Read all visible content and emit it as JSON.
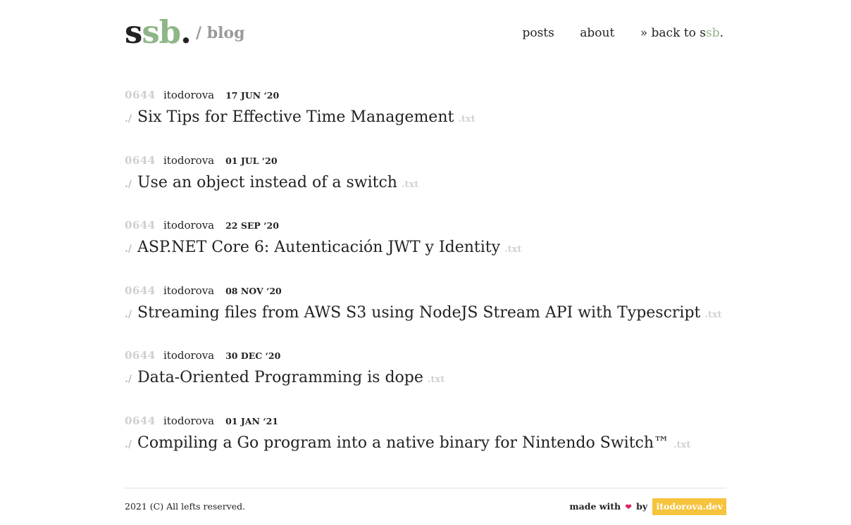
{
  "header": {
    "logo_part1": "s",
    "logo_part2": "sb",
    "logo_part3": ".",
    "section": "/ blog",
    "nav": {
      "posts": "posts",
      "about": "about",
      "back_prefix": "» back to s",
      "back_accent": "sb",
      "back_suffix": "."
    }
  },
  "posts": [
    {
      "perm": "0644",
      "author": "itodorova",
      "date": "17 JUN ‘20",
      "prefix": "./",
      "title": "Six Tips for Effective Time Management",
      "ext": ".txt"
    },
    {
      "perm": "0644",
      "author": "itodorova",
      "date": "01 JUL ‘20",
      "prefix": "./",
      "title": "Use an object instead of a switch",
      "ext": ".txt"
    },
    {
      "perm": "0644",
      "author": "itodorova",
      "date": "22 SEP ‘20",
      "prefix": "./",
      "title": "ASP.NET Core 6: Autenticación JWT y Identity",
      "ext": ".txt"
    },
    {
      "perm": "0644",
      "author": "itodorova",
      "date": "08 NOV ‘20",
      "prefix": "./",
      "title": "Streaming files from AWS S3 using NodeJS Stream API with Typescript",
      "ext": ".txt"
    },
    {
      "perm": "0644",
      "author": "itodorova",
      "date": "30 DEC ‘20",
      "prefix": "./",
      "title": "Data-Oriented Programming is dope",
      "ext": ".txt"
    },
    {
      "perm": "0644",
      "author": "itodorova",
      "date": "01 JAN ‘21",
      "prefix": "./",
      "title": "Compiling a Go program into a native binary for Nintendo Switch™",
      "ext": ".txt"
    }
  ],
  "footer": {
    "copyright": "2021 (C) All lefts reserved.",
    "made_with": "made with",
    "heart_icon": "❤",
    "by": "by",
    "link": "itodorova.dev"
  },
  "colors": {
    "accent": "#8fb686",
    "badge": "#f6c33d",
    "heart": "#e0245e"
  }
}
